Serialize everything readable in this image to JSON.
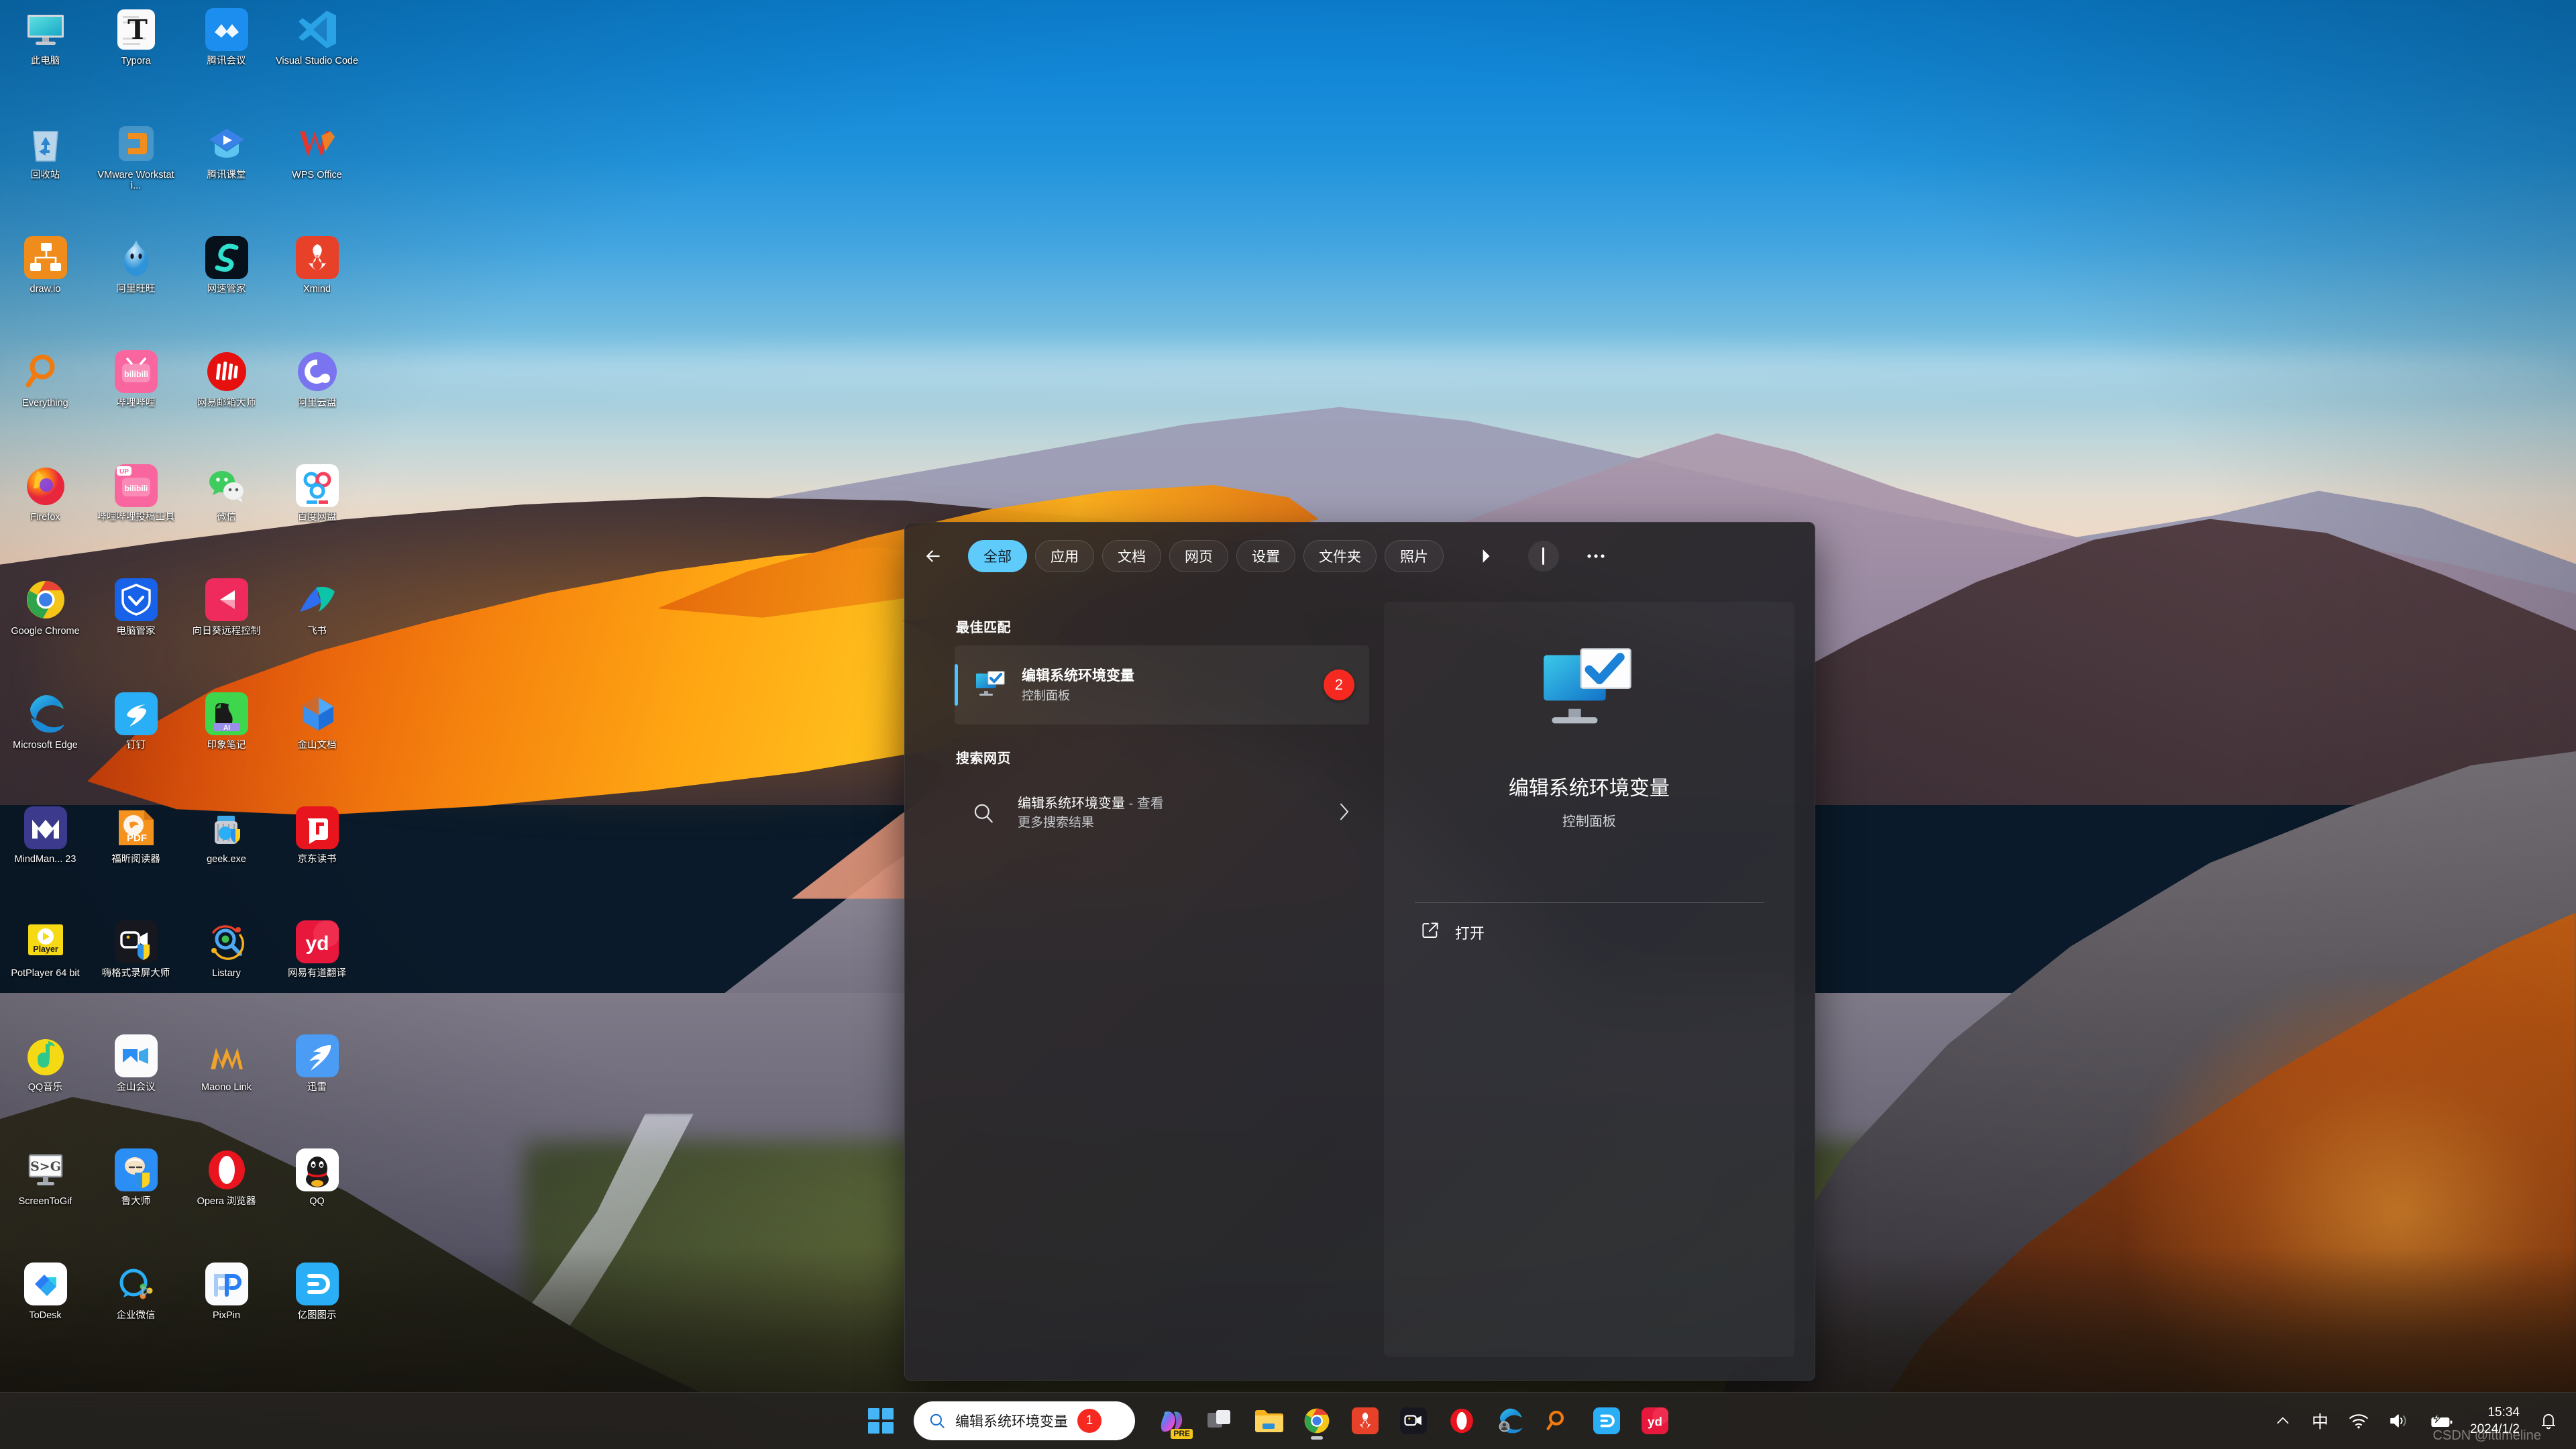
{
  "desktop": {
    "icons": [
      {
        "label": "此电脑",
        "icon": "this-pc-icon",
        "kind": "monitor"
      },
      {
        "label": "Typora",
        "icon": "typora-icon",
        "kind": "typora"
      },
      {
        "label": "腾讯会议",
        "icon": "tencent-meeting-icon",
        "kind": "tmeeting"
      },
      {
        "label": "Visual Studio Code",
        "icon": "vscode-icon",
        "kind": "vscode"
      },
      {
        "label": "回收站",
        "icon": "recycle-bin-icon",
        "kind": "recycle"
      },
      {
        "label": "VMware Workstati...",
        "icon": "vmware-icon",
        "kind": "vmware"
      },
      {
        "label": "腾讯课堂",
        "icon": "tencent-ketang-icon",
        "kind": "ketang"
      },
      {
        "label": "WPS Office",
        "icon": "wps-office-icon",
        "kind": "wps"
      },
      {
        "label": "draw.io",
        "icon": "drawio-icon",
        "kind": "drawio"
      },
      {
        "label": "阿里旺旺",
        "icon": "aliwangwang-icon",
        "kind": "wangwang"
      },
      {
        "label": "网速管家",
        "icon": "netspeed-icon",
        "kind": "netspeed"
      },
      {
        "label": "Xmind",
        "icon": "xmind-icon",
        "kind": "xmind"
      },
      {
        "label": "Everything",
        "icon": "everything-icon",
        "kind": "everything"
      },
      {
        "label": "哔哩哔哩",
        "icon": "bilibili-icon",
        "kind": "bilibili"
      },
      {
        "label": "网易邮箱大师",
        "icon": "netease-mail-icon",
        "kind": "neteasemail"
      },
      {
        "label": "阿里云盘",
        "icon": "aliyun-drive-icon",
        "kind": "aliyundrive"
      },
      {
        "label": "Firefox",
        "icon": "firefox-icon",
        "kind": "firefox"
      },
      {
        "label": "哔哩哔哩投稿工具",
        "icon": "bilibili-upload-icon",
        "kind": "biliup"
      },
      {
        "label": "微信",
        "icon": "wechat-icon",
        "kind": "wechat"
      },
      {
        "label": "百度网盘",
        "icon": "baidu-netdisk-icon",
        "kind": "baidupan"
      },
      {
        "label": "Google Chrome",
        "icon": "chrome-icon",
        "kind": "chrome"
      },
      {
        "label": "电脑管家",
        "icon": "tencent-pcmgr-icon",
        "kind": "pcmgr"
      },
      {
        "label": "向日葵远程控制",
        "icon": "sunflower-remote-icon",
        "kind": "sunflower"
      },
      {
        "label": "飞书",
        "icon": "feishu-icon",
        "kind": "feishu"
      },
      {
        "label": "Microsoft Edge",
        "icon": "edge-icon",
        "kind": "edge"
      },
      {
        "label": "钉钉",
        "icon": "dingtalk-icon",
        "kind": "dingtalk"
      },
      {
        "label": "印象笔记",
        "icon": "evernote-icon",
        "kind": "evernote"
      },
      {
        "label": "金山文档",
        "icon": "kingsoft-docs-icon",
        "kind": "ksdocs"
      },
      {
        "label": "MindMan... 23",
        "icon": "mindmanager-icon",
        "kind": "mindmanager"
      },
      {
        "label": "福昕阅读器",
        "icon": "foxit-reader-icon",
        "kind": "foxit"
      },
      {
        "label": "geek.exe",
        "icon": "geek-uninstaller-icon",
        "kind": "geek"
      },
      {
        "label": "京东读书",
        "icon": "jd-read-icon",
        "kind": "jdread"
      },
      {
        "label": "PotPlayer 64 bit",
        "icon": "potplayer-icon",
        "kind": "potplayer"
      },
      {
        "label": "嗨格式录屏大师",
        "icon": "higeshi-recorder-icon",
        "kind": "higeshi"
      },
      {
        "label": "Listary",
        "icon": "listary-icon",
        "kind": "listary"
      },
      {
        "label": "网易有道翻译",
        "icon": "youdao-translate-icon",
        "kind": "youdao"
      },
      {
        "label": "QQ音乐",
        "icon": "qq-music-icon",
        "kind": "qqmusic"
      },
      {
        "label": "金山会议",
        "icon": "kingsoft-meeting-icon",
        "kind": "ksmeeting"
      },
      {
        "label": "Maono Link",
        "icon": "maono-link-icon",
        "kind": "maono"
      },
      {
        "label": "迅雷",
        "icon": "thunder-icon",
        "kind": "thunder"
      },
      {
        "label": "ScreenToGif",
        "icon": "screentogif-icon",
        "kind": "screentogif"
      },
      {
        "label": "鲁大师",
        "icon": "ludashi-icon",
        "kind": "ludashi"
      },
      {
        "label": "Opera 浏览器",
        "icon": "opera-icon",
        "kind": "opera"
      },
      {
        "label": "QQ",
        "icon": "qq-icon",
        "kind": "qq"
      },
      {
        "label": "ToDesk",
        "icon": "todesk-icon",
        "kind": "todesk"
      },
      {
        "label": "企业微信",
        "icon": "wecom-icon",
        "kind": "wecom"
      },
      {
        "label": "PixPin",
        "icon": "pixpin-icon",
        "kind": "pixpin"
      },
      {
        "label": "亿图图示",
        "icon": "edraw-icon",
        "kind": "edraw"
      }
    ]
  },
  "search_panel": {
    "back_label": "返回",
    "filters": [
      {
        "label": "全部",
        "active": true
      },
      {
        "label": "应用",
        "active": false
      },
      {
        "label": "文档",
        "active": false
      },
      {
        "label": "网页",
        "active": false
      },
      {
        "label": "设置",
        "active": false
      },
      {
        "label": "文件夹",
        "active": false
      },
      {
        "label": "照片",
        "active": false
      }
    ],
    "next_label": "更多筛选",
    "more_label": "...",
    "best_match": {
      "section_title": "最佳匹配",
      "title": "编辑系统环境变量",
      "subtitle": "控制面板",
      "badge": "2"
    },
    "web_search": {
      "section_title": "搜索网页",
      "line1_main": "编辑系统环境变量",
      "line1_sep": " - ",
      "line1_dim": "查看",
      "line2": "更多搜索结果"
    },
    "preview": {
      "title": "编辑系统环境变量",
      "subtitle": "控制面板",
      "action_label": "打开"
    },
    "accent_color": "#5ecbfb",
    "badge_color": "#f5291f",
    "selection_color": "#4cc2ff"
  },
  "taskbar": {
    "start_label": "开始",
    "search": {
      "value": "编辑系统环境变量",
      "badge": "1",
      "icon": "search-icon"
    },
    "apps": [
      {
        "name": "copilot-icon",
        "label": "Copilot",
        "badge": "PRE",
        "running": false
      },
      {
        "name": "task-view-icon",
        "label": "任务视图",
        "running": false
      },
      {
        "name": "file-explorer-icon",
        "label": "文件资源管理器",
        "running": false
      },
      {
        "name": "chrome-icon",
        "label": "Google Chrome",
        "running": true
      },
      {
        "name": "xmind-icon",
        "label": "Xmind",
        "running": false
      },
      {
        "name": "higeshi-recorder-icon",
        "label": "嗨格式录屏大师",
        "running": false
      },
      {
        "name": "opera-icon",
        "label": "Opera 浏览器",
        "running": false
      },
      {
        "name": "edge-icon",
        "label": "Microsoft Edge",
        "running": false
      },
      {
        "name": "everything-icon",
        "label": "Everything",
        "running": false
      },
      {
        "name": "edraw-icon",
        "label": "亿图图示",
        "running": false
      },
      {
        "name": "youdao-icon",
        "label": "网易有道翻译",
        "running": false
      }
    ],
    "tray": [
      {
        "name": "show-hidden-icons-chevron",
        "glyph": "chevron-up"
      },
      {
        "name": "ime-indicator",
        "glyph": "中"
      },
      {
        "name": "wifi-icon",
        "glyph": "wifi"
      },
      {
        "name": "volume-icon",
        "glyph": "volume"
      },
      {
        "name": "battery-charging-icon",
        "glyph": "battery"
      }
    ],
    "clock": {
      "time": "15:34",
      "date": "2024/1/2"
    },
    "notification_label": "通知"
  },
  "watermark": {
    "text": "CSDN @ittimeline"
  }
}
